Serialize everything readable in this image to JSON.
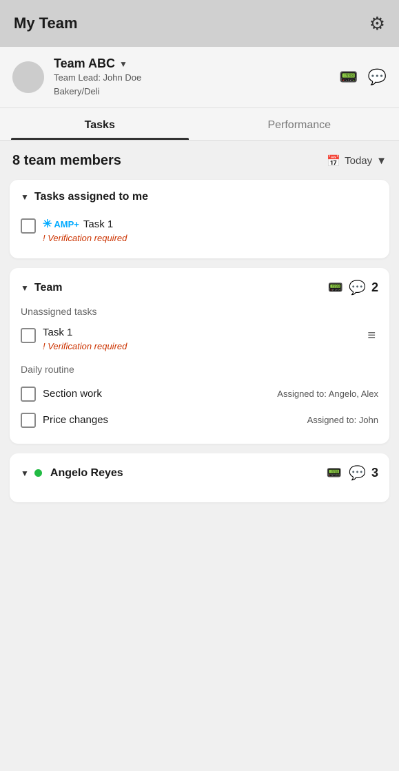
{
  "header": {
    "title": "My Team",
    "gear_label": "settings"
  },
  "team": {
    "name": "Team ABC",
    "lead_label": "Team Lead: John Doe",
    "department": "Bakery/Deli",
    "dropdown_arrow": "▼"
  },
  "tabs": [
    {
      "label": "Tasks",
      "active": true
    },
    {
      "label": "Performance",
      "active": false
    }
  ],
  "members_header": {
    "count_text": "8 team members",
    "date_label": "Today",
    "dropdown_arrow": "▼"
  },
  "assigned_card": {
    "section_arrow": "▼",
    "title": "Tasks assigned to me",
    "task": {
      "amp_star": "✳",
      "amp_plus": "AMP+",
      "name": "Task 1",
      "verification": "! Verification required"
    }
  },
  "team_card": {
    "section_arrow": "▼",
    "title": "Team",
    "badge": "2",
    "unassigned_label": "Unassigned tasks",
    "unassigned_task": {
      "name": "Task 1",
      "verification": "! Verification required"
    },
    "daily_label": "Daily routine",
    "daily_tasks": [
      {
        "name": "Section work",
        "assigned": "Assigned to: Angelo, Alex"
      },
      {
        "name": "Price changes",
        "assigned": "Assigned to: John"
      }
    ]
  },
  "angelo_card": {
    "section_arrow": "▼",
    "online": true,
    "name": "Angelo Reyes",
    "badge": "3"
  },
  "icons": {
    "gear": "⚙",
    "walkie_talkie": "📟",
    "chat_bubble": "💬",
    "calendar": "📅",
    "hamburger": "≡"
  }
}
